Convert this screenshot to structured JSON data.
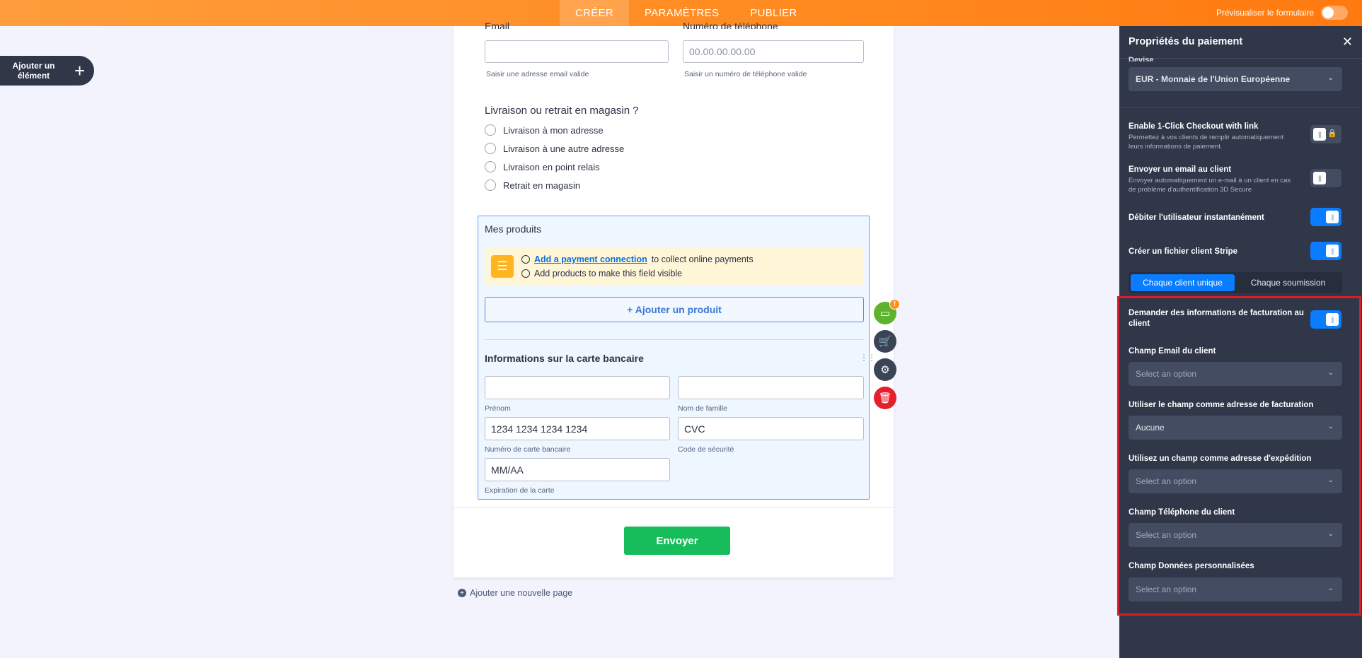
{
  "topbar": {
    "tabs": [
      {
        "label": "CRÉER",
        "active": true
      },
      {
        "label": "PARAMÈTRES",
        "active": false
      },
      {
        "label": "PUBLIER",
        "active": false
      }
    ],
    "preview_label": "Prévisualiser le formulaire"
  },
  "sidebar": {
    "add_element_label": "Ajouter un élément",
    "add_icon": "+"
  },
  "form": {
    "email_label": "Email",
    "email_value": "",
    "email_sub": "Saisir une adresse email valide",
    "phone_label": "Numéro de téléphone",
    "phone_placeholder": "00.00.00.00.00",
    "phone_sub": "Saisir un numéro de téléphone valide",
    "delivery_question": "Livraison ou retrait en magasin ?",
    "delivery_options": [
      "Livraison à mon adresse",
      "Livraison à une autre adresse",
      "Livraison en point relais",
      "Retrait en magasin"
    ],
    "products_title": "Mes produits",
    "notice": {
      "link_text": "Add a payment connection",
      "line1_rest": "to collect online payments",
      "line2": "Add products to make this field visible"
    },
    "add_product_label": "+ Ajouter un produit",
    "card_title": "Informations sur la carte bancaire",
    "first_name_value": "",
    "first_name_sub": "Prénom",
    "last_name_value": "",
    "last_name_sub": "Nom de famille",
    "card_number_placeholder": "1234 1234 1234 1234",
    "card_number_sub": "Numéro de carte bancaire",
    "cvc_placeholder": "CVC",
    "cvc_sub": "Code de sécurité",
    "expiry_placeholder": "MM/AA",
    "expiry_sub": "Expiration de la carte",
    "submit_label": "Envoyer",
    "add_page_label": "Ajouter une nouvelle page",
    "badge": "!"
  },
  "panel": {
    "title": "Propriétés du paiement",
    "clipped_label": "Devise",
    "currency_value": "EUR - Monnaie de l'Union Européenne",
    "link_checkout_title": "Enable 1-Click Checkout with link",
    "link_checkout_desc": "Permettez à vos clients de remplir automatiquement leurs informations de paiement.",
    "email_client_title": "Envoyer un email au client",
    "email_client_desc": "Envoyer automatiquement un e-mail à un client en cas de problème d'authentification 3D Secure",
    "charge_title": "Débiter l'utilisateur instantanément",
    "stripe_title": "Créer un fichier client Stripe",
    "segment": [
      "Chaque client unique",
      "Chaque soumission"
    ],
    "billing_title": "Demander des informations de facturation au client",
    "email_field_title": "Champ Email du client",
    "email_field_value": "Select an option",
    "billing_addr_title": "Utiliser le champ comme adresse de facturation",
    "billing_addr_value": "Aucune",
    "shipping_addr_title": "Utilisez un champ comme adresse d'expédition",
    "shipping_addr_value": "Select an option",
    "phone_field_title": "Champ Téléphone du client",
    "phone_field_value": "Select an option",
    "custom_field_title": "Champ Données personnalisées",
    "custom_field_value": "Select an option",
    "toggles": {
      "link_checkout": false,
      "email_client": false,
      "charge_instantly": true,
      "stripe_customer": true,
      "billing_info": true
    }
  },
  "colors": {
    "accent_orange": "#ff8a1f",
    "panel_bg": "#2f3749",
    "toggle_on": "#0a7cff",
    "submit_green": "#18bd5b",
    "highlight_red": "#d3202b"
  }
}
